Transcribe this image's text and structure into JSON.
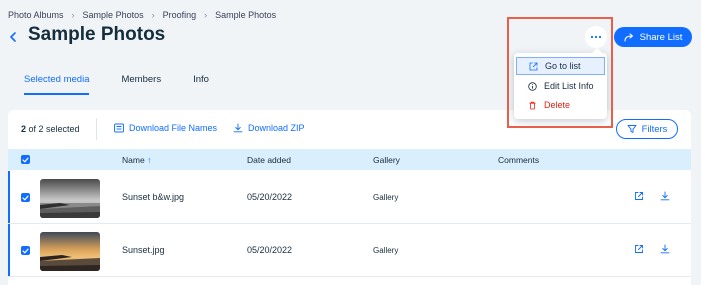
{
  "breadcrumb": [
    "Photo Albums",
    "Sample Photos",
    "Proofing",
    "Sample Photos"
  ],
  "header": {
    "title": "Sample Photos",
    "share_label": "Share List"
  },
  "tabs": [
    "Selected media",
    "Members",
    "Info"
  ],
  "toolbar": {
    "selected_count": "2",
    "selected_suffix": " of 2 selected",
    "download_names": "Download File Names",
    "download_zip": "Download ZIP",
    "filters": "Filters"
  },
  "table": {
    "columns": {
      "name": "Name",
      "sort_arrow": "↑",
      "date_added": "Date added",
      "gallery": "Gallery",
      "comments": "Comments"
    },
    "rows": [
      {
        "name": "Sunset b&w.jpg",
        "date": "05/20/2022",
        "gallery": "Gallery",
        "comments": ""
      },
      {
        "name": "Sunset.jpg",
        "date": "05/20/2022",
        "gallery": "Gallery",
        "comments": ""
      }
    ]
  },
  "menu": {
    "items": [
      {
        "label": "Go to list",
        "icon": "external-link-icon"
      },
      {
        "label": "Edit List Info",
        "icon": "info-icon"
      },
      {
        "label": "Delete",
        "icon": "trash-icon"
      }
    ]
  },
  "colors": {
    "accent": "#116dff",
    "danger": "#e62214",
    "highlight": "#e8604c",
    "header_bg": "#daeffe"
  }
}
